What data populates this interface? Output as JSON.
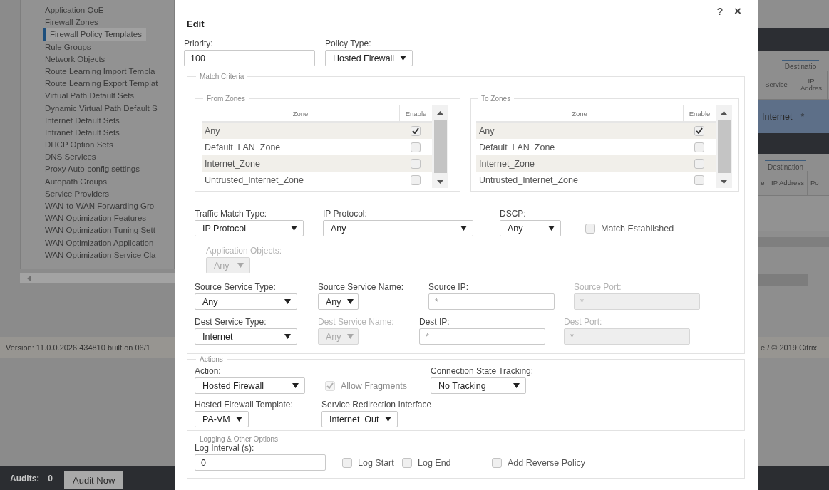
{
  "nav": {
    "items": [
      {
        "label": "Application QoE",
        "selected": false
      },
      {
        "label": "Firewall Zones",
        "selected": false
      },
      {
        "label": "Firewall Policy Templates",
        "selected": true
      },
      {
        "label": "Rule Groups",
        "selected": false
      },
      {
        "label": "Network Objects",
        "selected": false
      },
      {
        "label": "Route Learning Import Templa",
        "selected": false
      },
      {
        "label": "Route Learning Export Templat",
        "selected": false
      },
      {
        "label": "Virtual Path Default Sets",
        "selected": false
      },
      {
        "label": "Dynamic Virtual Path Default S",
        "selected": false
      },
      {
        "label": "Internet Default Sets",
        "selected": false
      },
      {
        "label": "Intranet Default Sets",
        "selected": false
      },
      {
        "label": "DHCP Option Sets",
        "selected": false
      },
      {
        "label": "DNS Services",
        "selected": false
      },
      {
        "label": "Proxy Auto-config settings",
        "selected": false
      },
      {
        "label": "Autopath Groups",
        "selected": false
      },
      {
        "label": "Service Providers",
        "selected": false
      },
      {
        "label": "WAN-to-WAN Forwarding Gro",
        "selected": false
      },
      {
        "label": "WAN Optimization Features",
        "selected": false
      },
      {
        "label": "WAN Optimization Tuning Sett",
        "selected": false
      },
      {
        "label": "WAN Optimization Application",
        "selected": false
      },
      {
        "label": "WAN Optimization Service Cla",
        "selected": false
      }
    ]
  },
  "version": "Version: 11.0.0.2026.434810 built on 06/1",
  "background_table": {
    "group_header_1": "Destinatio",
    "columns_1": [
      "Service",
      "IP Addres"
    ],
    "row": [
      "Internet",
      "*"
    ],
    "group_header_2": "Destination",
    "columns_2": [
      "e",
      "IP Address",
      "Po"
    ],
    "footer": "e / © 2019 Citrix"
  },
  "audits": {
    "label": "Audits:",
    "count": "0",
    "button": "Audit Now"
  },
  "dialog": {
    "title": "Edit",
    "help": "?",
    "close": "×",
    "priority": {
      "kind": "text",
      "label": "Priority:",
      "value": "100",
      "disabled": false
    },
    "policy_type": {
      "kind": "select",
      "label": "Policy Type:",
      "value": "Hosted Firewall",
      "disabled": false
    },
    "match_criteria": {
      "legend": "Match Criteria",
      "from_zones": {
        "legend": "From Zones",
        "columns": [
          "Zone",
          "Enable"
        ],
        "rows": [
          {
            "zone": "Any",
            "enabled": true
          },
          {
            "zone": "Default_LAN_Zone",
            "enabled": false
          },
          {
            "zone": "Internet_Zone",
            "enabled": false
          },
          {
            "zone": "Untrusted_Internet_Zone",
            "enabled": false
          }
        ]
      },
      "to_zones": {
        "legend": "To Zones",
        "columns": [
          "Zone",
          "Enable"
        ],
        "rows": [
          {
            "zone": "Any",
            "enabled": true
          },
          {
            "zone": "Default_LAN_Zone",
            "enabled": false
          },
          {
            "zone": "Internet_Zone",
            "enabled": false
          },
          {
            "zone": "Untrusted_Internet_Zone",
            "enabled": false
          }
        ]
      },
      "traffic_match_type": {
        "kind": "select",
        "label": "Traffic Match Type:",
        "value": "IP Protocol",
        "disabled": false
      },
      "ip_protocol": {
        "kind": "select",
        "label": "IP Protocol:",
        "value": "Any",
        "disabled": false
      },
      "dscp": {
        "kind": "select",
        "label": "DSCP:",
        "value": "Any",
        "disabled": false
      },
      "match_established": {
        "label": "Match Established",
        "checked": false,
        "disabled": false
      },
      "application_objects": {
        "kind": "select",
        "label": "Application Objects:",
        "value": "Any",
        "disabled": true
      },
      "source_service_type": {
        "kind": "select",
        "label": "Source Service Type:",
        "value": "Any",
        "disabled": false
      },
      "source_service_name": {
        "kind": "select",
        "label": "Source Service Name:",
        "value": "Any",
        "disabled": false
      },
      "source_ip": {
        "kind": "text",
        "label": "Source IP:",
        "placeholder": "*",
        "disabled": false
      },
      "source_port": {
        "kind": "text",
        "label": "Source Port:",
        "placeholder": "*",
        "disabled": true
      },
      "dest_service_type": {
        "kind": "select",
        "label": "Dest Service Type:",
        "value": "Internet",
        "disabled": false
      },
      "dest_service_name": {
        "kind": "select",
        "label": "Dest Service Name:",
        "value": "Any",
        "disabled": true
      },
      "dest_ip": {
        "kind": "text",
        "label": "Dest IP:",
        "placeholder": "*",
        "disabled": false
      },
      "dest_port": {
        "kind": "text",
        "label": "Dest Port:",
        "placeholder": "*",
        "disabled": true
      }
    },
    "actions": {
      "legend": "Actions",
      "action": {
        "kind": "select",
        "label": "Action:",
        "value": "Hosted Firewall",
        "disabled": false
      },
      "allow_fragments": {
        "label": "Allow Fragments",
        "checked": true,
        "disabled": true
      },
      "connection_state_tracking": {
        "kind": "select",
        "label": "Connection State Tracking:",
        "value": "No Tracking",
        "disabled": false
      },
      "hosted_firewall_template": {
        "kind": "select",
        "label": "Hosted Firewall Template:",
        "value": "PA-VM",
        "disabled": false
      },
      "service_redirection_interface": {
        "kind": "select",
        "label": "Service Redirection Interface",
        "value": "Internet_Out",
        "disabled": false
      }
    },
    "logging": {
      "legend": "Logging & Other Options",
      "log_interval": {
        "kind": "text",
        "label": "Log Interval (s):",
        "value": "0",
        "disabled": false
      },
      "log_start": {
        "label": "Log Start",
        "checked": false,
        "disabled": false
      },
      "log_end": {
        "label": "Log End",
        "checked": false,
        "disabled": false
      },
      "add_reverse_policy": {
        "label": "Add Reverse Policy",
        "checked": false,
        "disabled": false
      }
    }
  }
}
